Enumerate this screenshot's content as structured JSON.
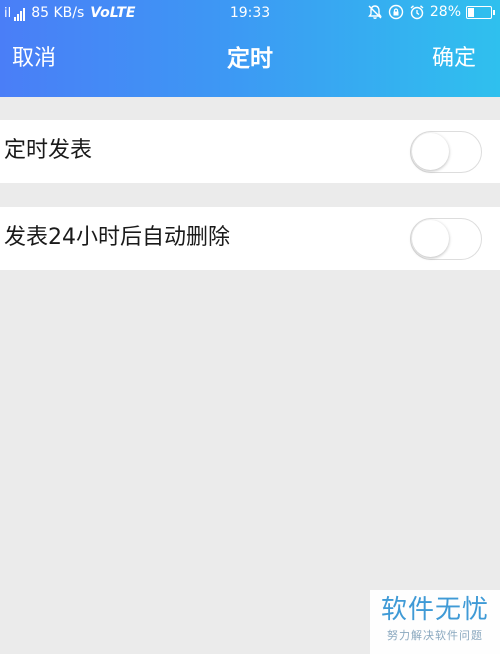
{
  "status_bar": {
    "signal_label": "il",
    "network_speed": "85 KB/s",
    "network_type": "VoLTE",
    "time": "19:33",
    "battery_percent": "28%",
    "battery_level": 0.28,
    "icons": [
      "signal-icon",
      "mute-bell-icon",
      "lock-rotation-icon",
      "alarm-icon",
      "battery-icon"
    ]
  },
  "title_bar": {
    "cancel_label": "取消",
    "title": "定时",
    "confirm_label": "确定"
  },
  "settings": [
    {
      "label": "定时发表",
      "enabled": false
    },
    {
      "label": "发表24小时后自动删除",
      "enabled": false
    }
  ],
  "watermark": {
    "title": "软件无忧",
    "subtitle": "努力解决软件问题"
  },
  "colors": {
    "header_gradient_start": "#4a7ef7",
    "header_gradient_end": "#2fc0ee",
    "background": "#ebebeb",
    "watermark_text": "#3f9ad6"
  }
}
